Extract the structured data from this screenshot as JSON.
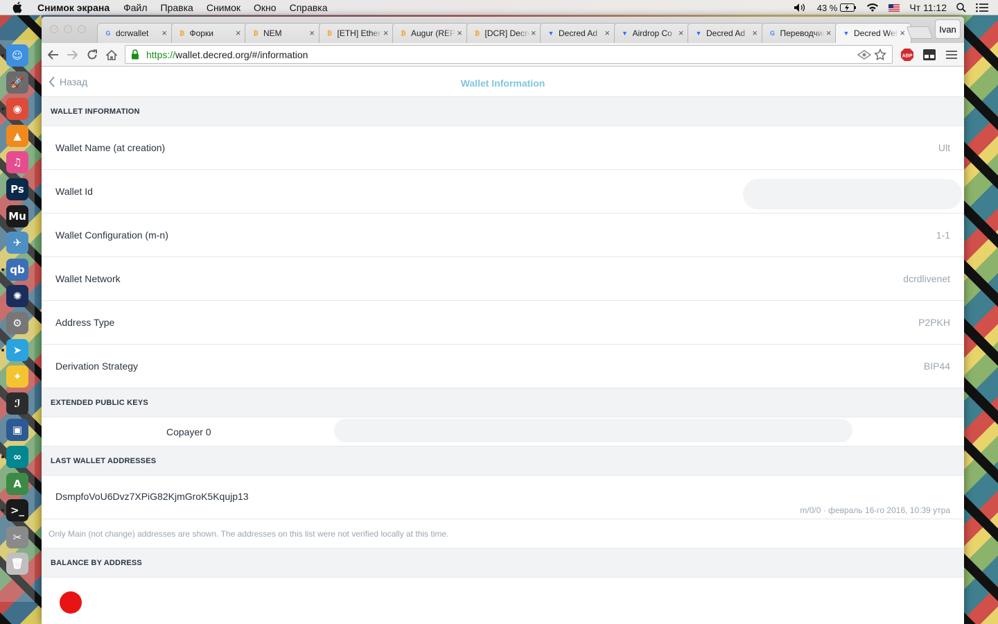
{
  "menubar": {
    "app_name": "Снимок экрана",
    "items": [
      "Файл",
      "Правка",
      "Снимок",
      "Окно",
      "Справка"
    ],
    "battery": "43 %",
    "clock": "Чт 11:12"
  },
  "dock": {
    "apps": [
      {
        "name": "finder-icon",
        "glyph": "☺",
        "color": "#3d8fe0"
      },
      {
        "name": "launchpad-icon",
        "glyph": "🚀",
        "color": "#6b6b6b"
      },
      {
        "name": "chrome-icon",
        "glyph": "◉",
        "color": "#dd4b39"
      },
      {
        "name": "vlc-icon",
        "glyph": "▲",
        "color": "#f08a1c"
      },
      {
        "name": "itunes-icon",
        "glyph": "♫",
        "color": "#e54d8e"
      },
      {
        "name": "photoshop-icon",
        "glyph": "Ps",
        "color": "#0b2a4a"
      },
      {
        "name": "muse-icon",
        "glyph": "Mu",
        "color": "#1a1a1a"
      },
      {
        "name": "preview-icon",
        "glyph": "✈",
        "color": "#4f90c4"
      },
      {
        "name": "qbittorrent-icon",
        "glyph": "qb",
        "color": "#3c6fb5"
      },
      {
        "name": "decred-icon",
        "glyph": "✺",
        "color": "#1b2d5a"
      },
      {
        "name": "automator-icon",
        "glyph": "⚙",
        "color": "#777777"
      },
      {
        "name": "telegram-icon",
        "glyph": "➤",
        "color": "#2aa3e0"
      },
      {
        "name": "tips-icon",
        "glyph": "✦",
        "color": "#f4c430"
      },
      {
        "name": "sublime-icon",
        "glyph": "ℐ",
        "color": "#2c2c2c"
      },
      {
        "name": "virtualbox-icon",
        "glyph": "▣",
        "color": "#2c5a94"
      },
      {
        "name": "arduino-icon",
        "glyph": "∞",
        "color": "#00878f"
      },
      {
        "name": "android-studio-icon",
        "glyph": "A",
        "color": "#3b8a46"
      },
      {
        "name": "terminal-icon",
        "glyph": ">_",
        "color": "#1a1a1a"
      },
      {
        "name": "screenshot-icon",
        "glyph": "✂",
        "color": "#8a8a8a"
      },
      {
        "name": "trash-icon",
        "glyph": "🗑",
        "color": "#bfbfbf"
      }
    ]
  },
  "browser": {
    "profile_name": "Ivan",
    "tabs": [
      {
        "title": "dcrwallet",
        "favicon": "G",
        "color": "#4285f4"
      },
      {
        "title": "Форки",
        "favicon": "₿",
        "color": "#f0a020"
      },
      {
        "title": "NEM",
        "favicon": "₿",
        "color": "#f0a020"
      },
      {
        "title": "[ETH] Ether",
        "favicon": "₿",
        "color": "#f0a020"
      },
      {
        "title": "Augur (REP)",
        "favicon": "₿",
        "color": "#f0a020"
      },
      {
        "title": "[DCR] Decred",
        "favicon": "₿",
        "color": "#f0a020"
      },
      {
        "title": "Decred Ad",
        "favicon": "▼",
        "color": "#2970ff"
      },
      {
        "title": "Airdrop Co",
        "favicon": "▼",
        "color": "#2970ff"
      },
      {
        "title": "Decred Ad",
        "favicon": "▼",
        "color": "#2970ff"
      },
      {
        "title": "Переводчик",
        "favicon": "G",
        "color": "#4285f4"
      },
      {
        "title": "Decred Web",
        "favicon": "▼",
        "color": "#2970ff"
      }
    ],
    "url_proto": "https://",
    "url_rest": "wallet.decred.org/#/information",
    "extension_abp": "ABP"
  },
  "page": {
    "back_label": "Назад",
    "title": "Wallet Information",
    "sections": {
      "wallet_info": "WALLET INFORMATION",
      "xpub": "EXTENDED PUBLIC KEYS",
      "last_addresses": "LAST WALLET ADDRESSES",
      "balance": "BALANCE BY ADDRESS"
    },
    "info_rows": [
      {
        "label": "Wallet Name (at creation)",
        "value": "Ult"
      },
      {
        "label": "Wallet Id",
        "value": ""
      },
      {
        "label": "Wallet Configuration (m-n)",
        "value": "1-1"
      },
      {
        "label": "Wallet Network",
        "value": "dcrdlivenet"
      },
      {
        "label": "Address Type",
        "value": "P2PKH"
      },
      {
        "label": "Derivation Strategy",
        "value": "BIP44"
      }
    ],
    "copayer_label": "Copayer 0",
    "address": "DsmpfoVoU6Dvz7XPiG82KjmGroK5Kqujp13",
    "address_meta": "m/0/0 · февраль 16-го 2016, 10:39 утра",
    "note": "Only Main (not change) addresses are shown. The addresses on this list were not verified locally at this time."
  }
}
